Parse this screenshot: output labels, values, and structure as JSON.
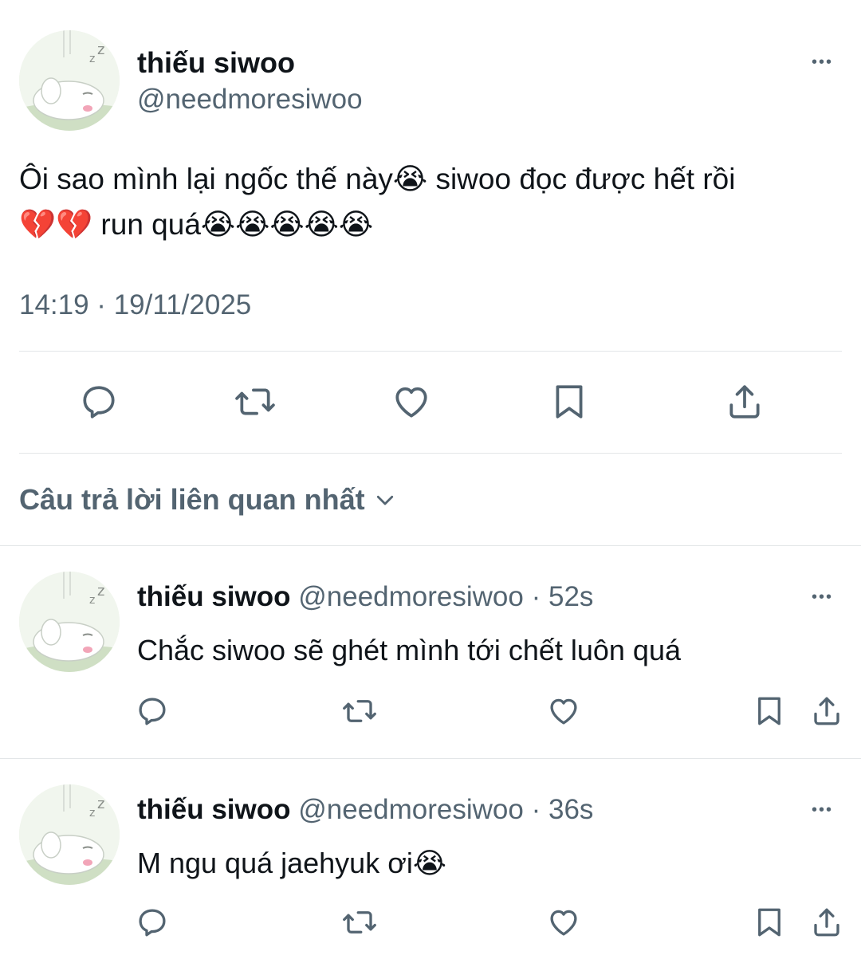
{
  "main_tweet": {
    "display_name": "thiếu siwoo",
    "handle": "@needmoresiwoo",
    "more_label": "•••",
    "text_line1": "Ôi sao mình lại ngốc thế này😭 siwoo đọc được hết rồi",
    "text_line2": "💔💔 run quá😭😭😭😭😭",
    "timestamp": "14:19 · 19/11/2025",
    "actions": [
      "reply-icon",
      "retweet-icon",
      "like-icon",
      "bookmark-icon",
      "share-icon"
    ]
  },
  "replies_sort": {
    "label": "Câu trả lời liên quan nhất",
    "icon": "chevron-down-icon"
  },
  "replies": [
    {
      "display_name": "thiếu siwoo",
      "handle": "@needmoresiwoo",
      "sep": "·",
      "time": "52s",
      "more_label": "•••",
      "text": "Chắc siwoo sẽ ghét mình tới chết luôn quá"
    },
    {
      "display_name": "thiếu siwoo",
      "handle": "@needmoresiwoo",
      "sep": "·",
      "time": "36s",
      "more_label": "•••",
      "text": "M ngu quá jaehyuk ơi😭"
    }
  ],
  "colors": {
    "text": "#0f1419",
    "muted": "#536471",
    "divider": "#e3e6e8",
    "background": "#ffffff"
  }
}
